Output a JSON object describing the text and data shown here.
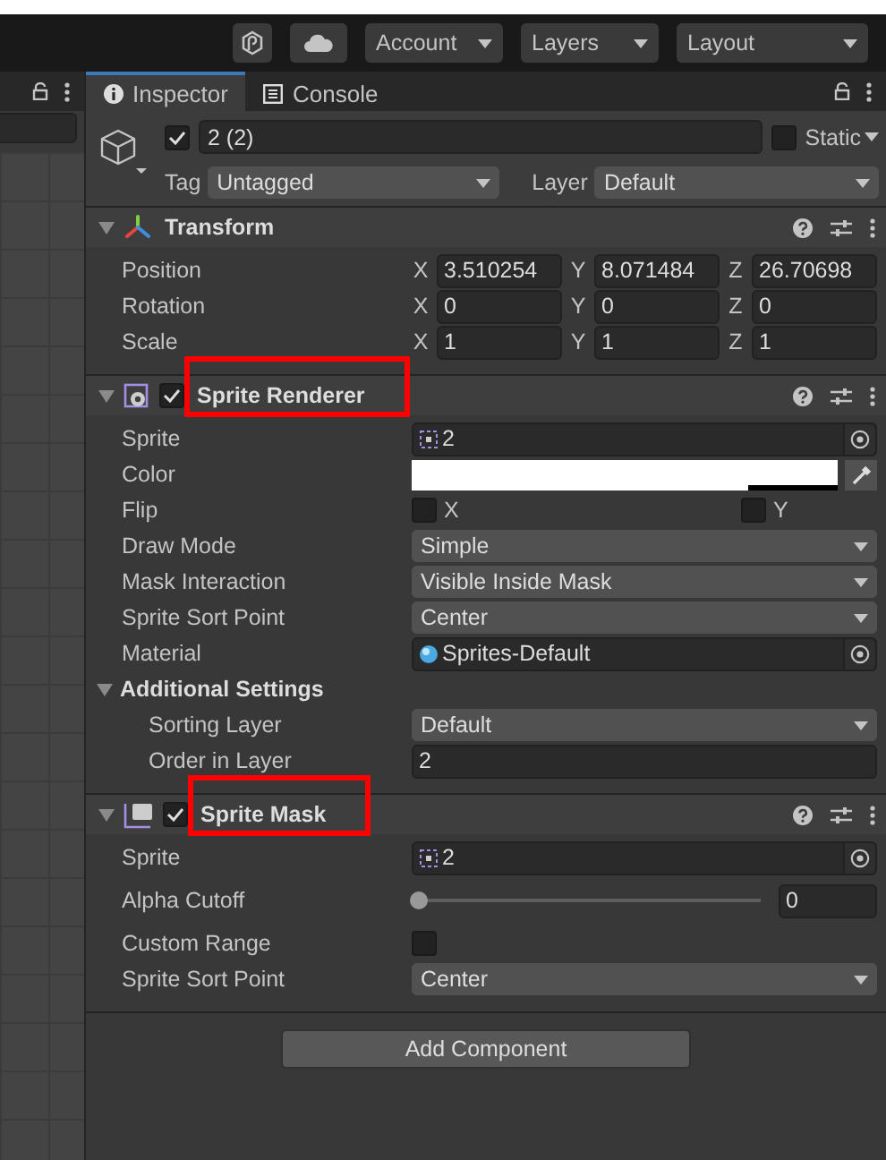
{
  "toolbar": {
    "dropdowns": [
      "Account",
      "Layers",
      "Layout"
    ]
  },
  "tabs": [
    {
      "label": "Inspector",
      "selected": true
    },
    {
      "label": "Console",
      "selected": false
    }
  ],
  "object": {
    "active": true,
    "name": "2 (2)",
    "static": false,
    "static_label": "Static",
    "tag_label": "Tag",
    "tag": "Untagged",
    "layer_label": "Layer",
    "layer": "Default"
  },
  "components": [
    {
      "title": "Transform",
      "kind": "transform",
      "expanded": true,
      "highlighted": false,
      "rows": [
        {
          "kind": "vector",
          "label": "Position",
          "fields": [
            {
              "axis": "X",
              "value": "3.510254"
            },
            {
              "axis": "Y",
              "value": "8.071484"
            },
            {
              "axis": "Z",
              "value": "26.70698"
            }
          ]
        },
        {
          "kind": "vector",
          "label": "Rotation",
          "fields": [
            {
              "axis": "X",
              "value": "0"
            },
            {
              "axis": "Y",
              "value": "0"
            },
            {
              "axis": "Z",
              "value": "0"
            }
          ]
        },
        {
          "kind": "vector",
          "label": "Scale",
          "fields": [
            {
              "axis": "X",
              "value": "1"
            },
            {
              "axis": "Y",
              "value": "1"
            },
            {
              "axis": "Z",
              "value": "1"
            }
          ]
        }
      ]
    },
    {
      "title": "Sprite Renderer",
      "kind": "sprite_renderer",
      "expanded": true,
      "enabled": true,
      "highlighted": true,
      "rows": [
        {
          "kind": "sprite",
          "label": "Sprite",
          "value": "2"
        },
        {
          "kind": "color",
          "label": "Color",
          "color": "#ffffff",
          "level": 0.79
        },
        {
          "kind": "flip",
          "label": "Flip",
          "options": [
            {
              "label": "X",
              "checked": false
            },
            {
              "label": "Y",
              "checked": false
            }
          ]
        },
        {
          "kind": "dropdown",
          "label": "Draw Mode",
          "value": "Simple"
        },
        {
          "kind": "dropdown",
          "label": "Mask Interaction",
          "value": "Visible Inside Mask"
        },
        {
          "kind": "dropdown",
          "label": "Sprite Sort Point",
          "value": "Center"
        },
        {
          "kind": "material",
          "label": "Material",
          "value": "Sprites-Default"
        },
        {
          "kind": "group",
          "label": "Additional Settings",
          "expanded": true,
          "children": [
            {
              "kind": "dropdown",
              "label": "Sorting Layer",
              "value": "Default"
            },
            {
              "kind": "number",
              "label": "Order in Layer",
              "value": "2"
            }
          ]
        }
      ]
    },
    {
      "title": "Sprite Mask",
      "kind": "sprite_mask",
      "expanded": true,
      "enabled": true,
      "highlighted": true,
      "rows": [
        {
          "kind": "sprite",
          "label": "Sprite",
          "value": "2"
        },
        {
          "kind": "slider",
          "label": "Alpha Cutoff",
          "level": 0,
          "value": "0"
        },
        {
          "kind": "checkbox",
          "label": "Custom Range",
          "checked": false
        },
        {
          "kind": "dropdown",
          "label": "Sprite Sort Point",
          "value": "Center"
        }
      ]
    }
  ],
  "add_component": "Add Component"
}
